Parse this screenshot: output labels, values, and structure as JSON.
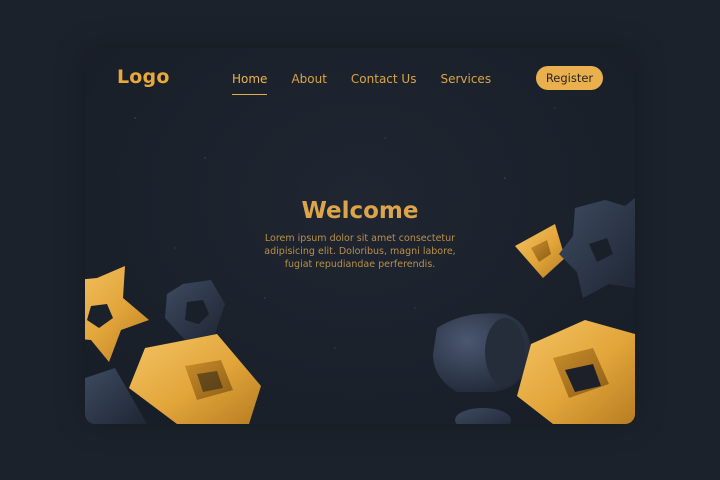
{
  "header": {
    "logo": "Logo",
    "nav": [
      {
        "label": "Home",
        "active": true
      },
      {
        "label": "About",
        "active": false
      },
      {
        "label": "Contact Us",
        "active": false
      },
      {
        "label": "Services",
        "active": false
      }
    ],
    "register_label": "Register"
  },
  "hero": {
    "title": "Welcome",
    "body": "Lorem ipsum dolor sit amet consectetur adipisicing elit. Doloribus, magni labore, fugiat repudiandae perferendis."
  },
  "colors": {
    "background": "#1c222c",
    "accent_gold": "#eab04e",
    "shape_dark": "#2b3445"
  }
}
